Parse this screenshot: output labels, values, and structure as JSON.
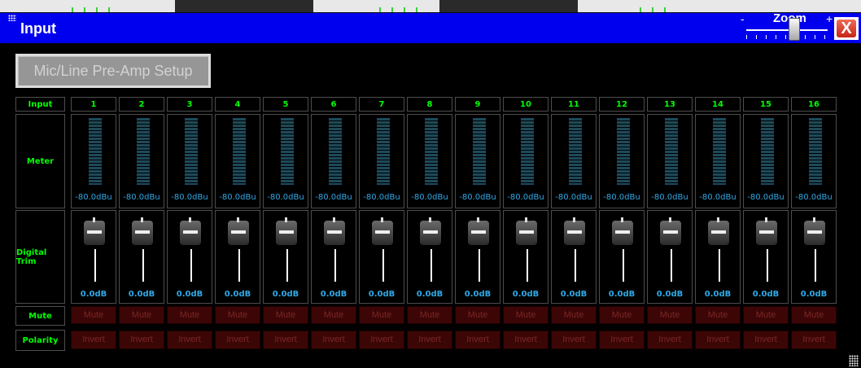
{
  "window": {
    "title": "Input"
  },
  "zoom": {
    "label": "Zoom",
    "minus": "-",
    "plus": "+",
    "level": 0.55
  },
  "close_label": "X",
  "preamp_button": "Mic/Line Pre-Amp Setup",
  "row_labels": {
    "input": "Input",
    "meter": "Meter",
    "trim": "Digital Trim",
    "mute": "Mute",
    "polarity": "Polarity"
  },
  "channels": [
    {
      "num": "1",
      "meter": "-80.0dBu",
      "trim": "0.0dB",
      "mute": "Mute",
      "invert": "Invert"
    },
    {
      "num": "2",
      "meter": "-80.0dBu",
      "trim": "0.0dB",
      "mute": "Mute",
      "invert": "Invert"
    },
    {
      "num": "3",
      "meter": "-80.0dBu",
      "trim": "0.0dB",
      "mute": "Mute",
      "invert": "Invert"
    },
    {
      "num": "4",
      "meter": "-80.0dBu",
      "trim": "0.0dB",
      "mute": "Mute",
      "invert": "Invert"
    },
    {
      "num": "5",
      "meter": "-80.0dBu",
      "trim": "0.0dB",
      "mute": "Mute",
      "invert": "Invert"
    },
    {
      "num": "6",
      "meter": "-80.0dBu",
      "trim": "0.0dB",
      "mute": "Mute",
      "invert": "Invert"
    },
    {
      "num": "7",
      "meter": "-80.0dBu",
      "trim": "0.0dB",
      "mute": "Mute",
      "invert": "Invert"
    },
    {
      "num": "8",
      "meter": "-80.0dBu",
      "trim": "0.0dB",
      "mute": "Mute",
      "invert": "Invert"
    },
    {
      "num": "9",
      "meter": "-80.0dBu",
      "trim": "0.0dB",
      "mute": "Mute",
      "invert": "Invert"
    },
    {
      "num": "10",
      "meter": "-80.0dBu",
      "trim": "0.0dB",
      "mute": "Mute",
      "invert": "Invert"
    },
    {
      "num": "11",
      "meter": "-80.0dBu",
      "trim": "0.0dB",
      "mute": "Mute",
      "invert": "Invert"
    },
    {
      "num": "12",
      "meter": "-80.0dBu",
      "trim": "0.0dB",
      "mute": "Mute",
      "invert": "Invert"
    },
    {
      "num": "13",
      "meter": "-80.0dBu",
      "trim": "0.0dB",
      "mute": "Mute",
      "invert": "Invert"
    },
    {
      "num": "14",
      "meter": "-80.0dBu",
      "trim": "0.0dB",
      "mute": "Mute",
      "invert": "Invert"
    },
    {
      "num": "15",
      "meter": "-80.0dBu",
      "trim": "0.0dB",
      "mute": "Mute",
      "invert": "Invert"
    },
    {
      "num": "16",
      "meter": "-80.0dBu",
      "trim": "0.0dB",
      "mute": "Mute",
      "invert": "Invert"
    }
  ],
  "colors": {
    "titlebar": "#0000ee",
    "label_green": "#00ff00",
    "value_blue": "#2ea9e6",
    "button_red": "#3d0606"
  }
}
